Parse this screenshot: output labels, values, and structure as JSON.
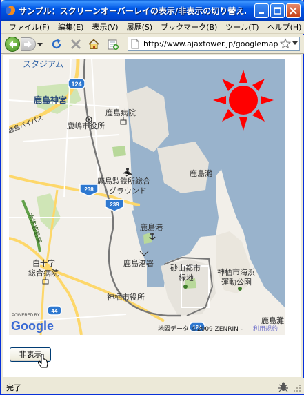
{
  "window": {
    "title": "サンプル：スクリーンオーバーレイの表示/非表示の切り替え..."
  },
  "menu": [
    {
      "label": "ファイル(F)"
    },
    {
      "label": "編集(E)"
    },
    {
      "label": "表示(V)"
    },
    {
      "label": "履歴(S)"
    },
    {
      "label": "ブックマーク(B)"
    },
    {
      "label": "ツール(T)"
    },
    {
      "label": "ヘルプ(H)"
    }
  ],
  "addressbar": {
    "url": "http://www.ajaxtower.jp/googlemap"
  },
  "map": {
    "labels": {
      "stadium": "スタジアム",
      "road_124": "124",
      "kashima_jingu": "鹿島神宮",
      "kashima_hospital": "鹿島病院",
      "kashima_city_hall": "鹿嶋市役所",
      "bypass": "鹿島バイパス",
      "steel_ground_1": "鹿島製鉄所総合",
      "steel_ground_2": "グラウンド",
      "kashima_nada": "鹿島灘",
      "road_238": "238",
      "road_239": "239",
      "kashima_port": "鹿島港",
      "rinko_railway": "大洗鹿島線",
      "hakujuji_1": "白十字",
      "hakujuji_2": "総合病院",
      "port_police": "鹿島港署",
      "sunayama_1": "砂山都市",
      "sunayama_2": "緑地",
      "kamisu_park_1": "神栖市海浜",
      "kamisu_park_2": "運動公園",
      "kamisu_city_hall": "神栖市役所",
      "kashima_nada_2": "鹿島灘",
      "road_44": "44",
      "road_124_south": "124",
      "powered_by": "POWERED BY",
      "google": "Google",
      "copyright": "地図データ ©2009 ZENRIN - ",
      "terms": "利用規約"
    },
    "overlay_icon": "sun-icon",
    "overlay_color": "#ff0000"
  },
  "toggle_button": {
    "label": "非表示"
  },
  "status": {
    "text": "完了"
  }
}
